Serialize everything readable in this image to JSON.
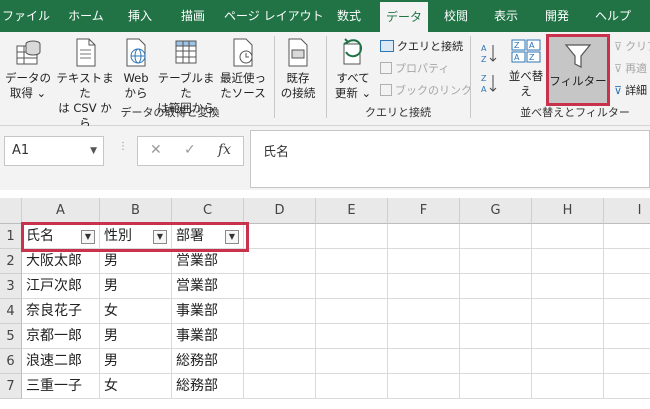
{
  "tabs": [
    "ファイル",
    "ホーム",
    "挿入",
    "描画",
    "ページ レイアウト",
    "数式",
    "データ",
    "校閲",
    "表示",
    "開発",
    "ヘルプ"
  ],
  "active_tab": "データ",
  "ribbon": {
    "get_data": {
      "line1": "データの",
      "line2": "取得 ⌄"
    },
    "text_csv": {
      "line1": "テキストまた",
      "line2": "は CSV から"
    },
    "web": {
      "line1": "Web",
      "line2": "から"
    },
    "table_range": {
      "line1": "テーブルまた",
      "line2": "は範囲から"
    },
    "recent_sources": {
      "line1": "最近使っ",
      "line2": "たソース"
    },
    "existing_conn": {
      "line1": "既存",
      "line2": "の接続"
    },
    "group_get_transform": "データの取得と変換",
    "refresh_all": {
      "line1": "すべて",
      "line2": "更新 ⌄"
    },
    "queries_connections": "クエリと接続",
    "properties": "プロパティ",
    "edit_links": "ブックのリンク",
    "group_queries": "クエリと接続",
    "sort": "並べ替え",
    "filter": "フィルター",
    "clear": "クリア",
    "reapply": "再適",
    "advanced": "詳細",
    "group_sort_filter": "並べ替えとフィルター"
  },
  "formula_bar": {
    "name_box": "A1",
    "cancel": "✕",
    "enter": "✓",
    "fx": "fx",
    "content": "氏名"
  },
  "columns": [
    "A",
    "B",
    "C",
    "D",
    "E",
    "F",
    "G",
    "H",
    "I"
  ],
  "rows": [
    {
      "num": "1",
      "a": "氏名",
      "b": "性別",
      "c": "部署"
    },
    {
      "num": "2",
      "a": "大阪太郎",
      "b": "男",
      "c": "営業部"
    },
    {
      "num": "3",
      "a": "江戸次郎",
      "b": "男",
      "c": "営業部"
    },
    {
      "num": "4",
      "a": "奈良花子",
      "b": "女",
      "c": "事業部"
    },
    {
      "num": "5",
      "a": "京都一郎",
      "b": "男",
      "c": "事業部"
    },
    {
      "num": "6",
      "a": "浪速二郎",
      "b": "男",
      "c": "総務部"
    },
    {
      "num": "7",
      "a": "三重一子",
      "b": "女",
      "c": "総務部"
    }
  ],
  "colors": {
    "accent": "#217346",
    "highlight": "#c8324c"
  }
}
